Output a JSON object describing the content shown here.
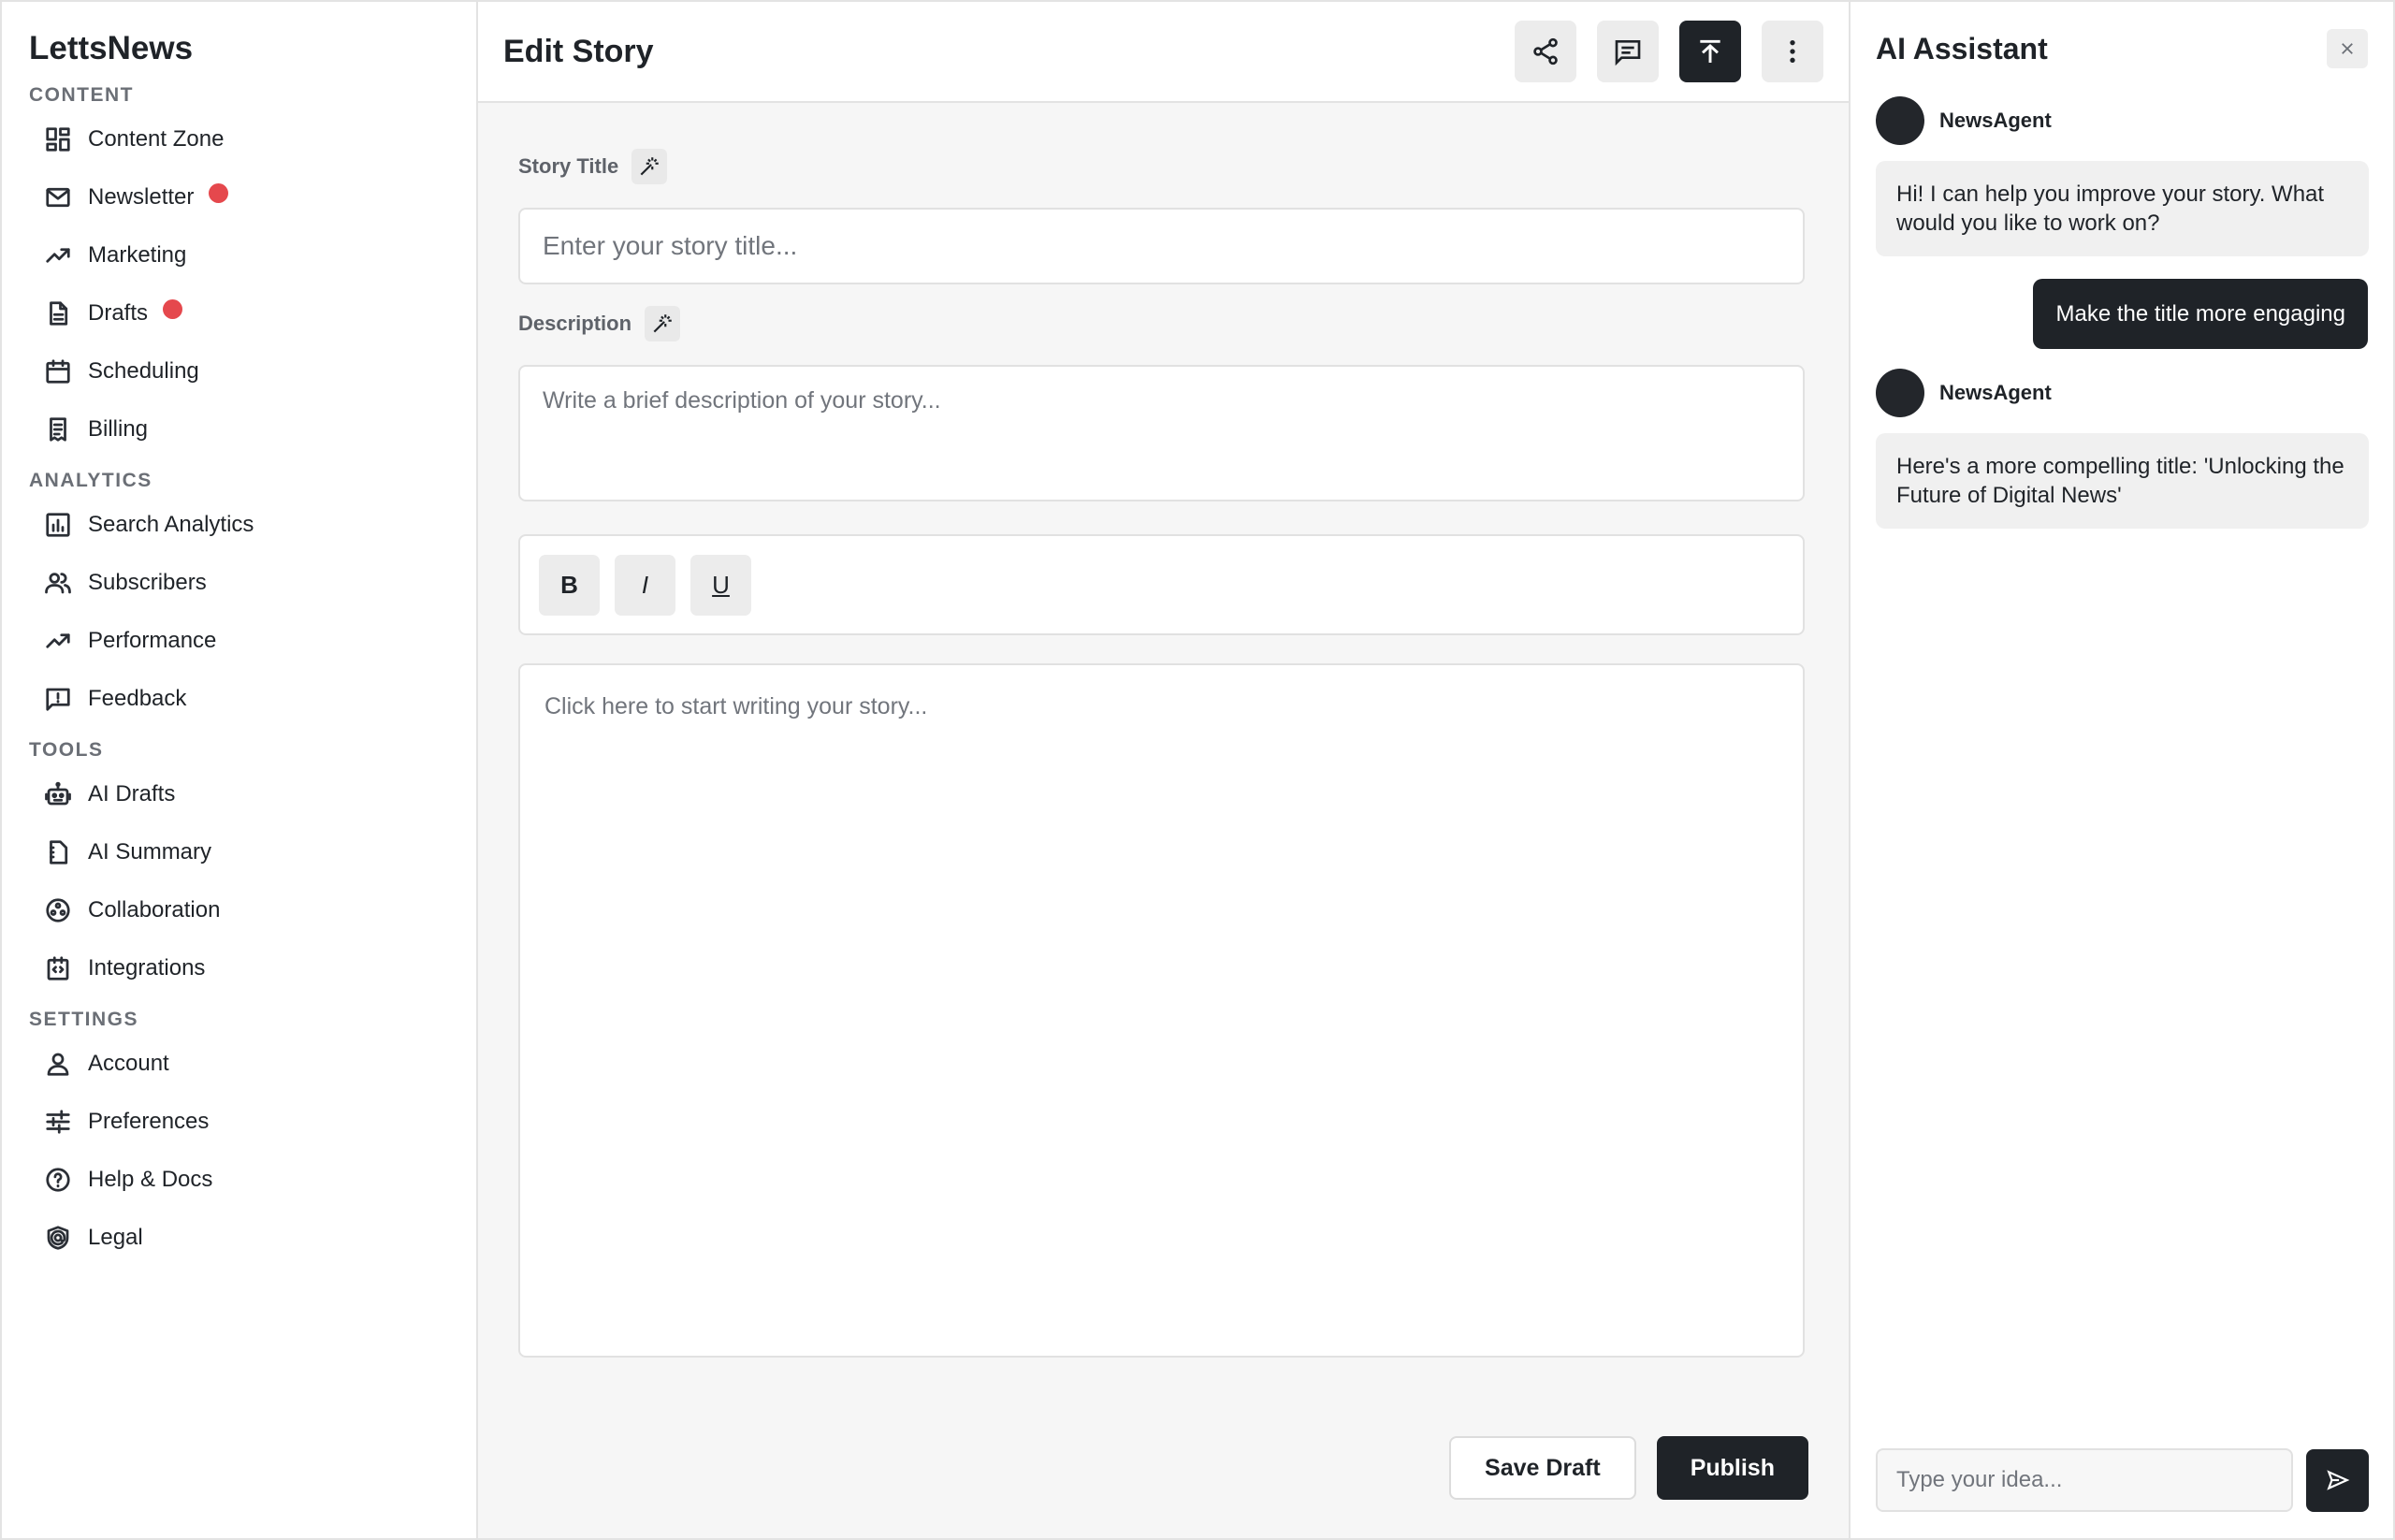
{
  "brand": "LettsNews",
  "sidebar": {
    "sections": [
      {
        "label": "CONTENT",
        "items": [
          {
            "label": "Content Zone",
            "icon": "dashboard-icon"
          },
          {
            "label": "Newsletter",
            "icon": "mail-icon",
            "dot": true
          },
          {
            "label": "Marketing",
            "icon": "trending-up-icon"
          },
          {
            "label": "Drafts",
            "icon": "document-icon",
            "dot": true
          },
          {
            "label": "Scheduling",
            "icon": "calendar-icon"
          },
          {
            "label": "Billing",
            "icon": "receipt-icon"
          }
        ]
      },
      {
        "label": "ANALYTICS",
        "items": [
          {
            "label": "Search Analytics",
            "icon": "bar-chart-icon"
          },
          {
            "label": "Subscribers",
            "icon": "users-icon"
          },
          {
            "label": "Performance",
            "icon": "trending-up-icon"
          },
          {
            "label": "Feedback",
            "icon": "feedback-icon"
          }
        ]
      },
      {
        "label": "TOOLS",
        "items": [
          {
            "label": "AI Drafts",
            "icon": "robot-icon"
          },
          {
            "label": "AI Summary",
            "icon": "summary-icon"
          },
          {
            "label": "Collaboration",
            "icon": "collaboration-icon"
          },
          {
            "label": "Integrations",
            "icon": "integrations-icon"
          }
        ]
      },
      {
        "label": "SETTINGS",
        "items": [
          {
            "label": "Account",
            "icon": "person-icon"
          },
          {
            "label": "Preferences",
            "icon": "sliders-icon"
          },
          {
            "label": "Help & Docs",
            "icon": "help-icon"
          },
          {
            "label": "Legal",
            "icon": "shield-icon"
          }
        ]
      }
    ]
  },
  "main": {
    "title": "Edit Story",
    "story_title_label": "Story Title",
    "story_title_placeholder": "Enter your story title...",
    "description_label": "Description",
    "description_placeholder": "Write a brief description of your story...",
    "format": {
      "bold": "B",
      "italic": "I",
      "underline": "U"
    },
    "editor_placeholder": "Click here to start writing your story...",
    "save_label": "Save Draft",
    "publish_label": "Publish"
  },
  "assistant": {
    "title": "AI Assistant",
    "agent_name": "NewsAgent",
    "messages": [
      {
        "from": "agent",
        "text": "Hi! I can help you improve your story. What would you like to work on?"
      },
      {
        "from": "user",
        "text": "Make the title more engaging"
      },
      {
        "from": "agent",
        "text": "Here's a more compelling title: 'Unlocking the Future of Digital News'"
      }
    ],
    "input_placeholder": "Type your idea..."
  },
  "colors": {
    "accent": "#1f2328",
    "badge": "#e5484d",
    "background": "#f6f6f6"
  }
}
